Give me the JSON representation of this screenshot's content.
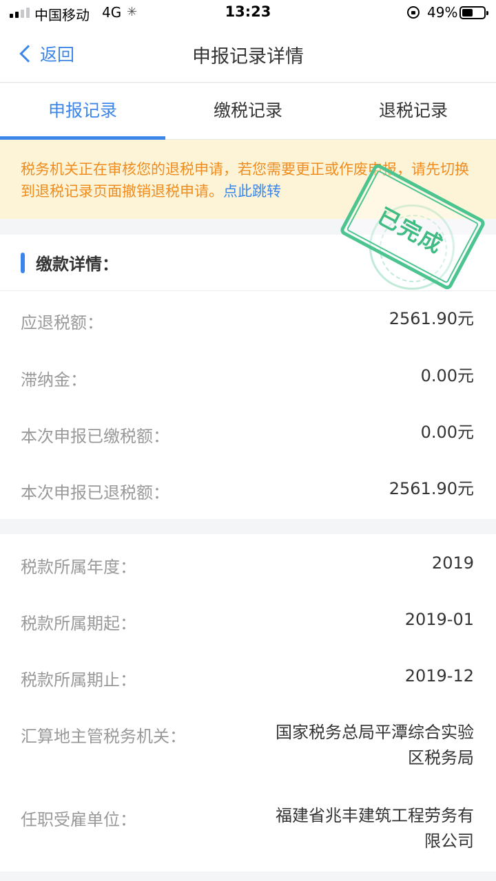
{
  "status_bar": {
    "carrier": "中国移动",
    "network": "4G",
    "time": "13:23",
    "battery_percent": "49%",
    "battery_level": 0.49
  },
  "nav": {
    "back_label": "返回",
    "title": "申报记录详情"
  },
  "tabs": [
    {
      "label": "申报记录",
      "active": true
    },
    {
      "label": "缴税记录",
      "active": false
    },
    {
      "label": "退税记录",
      "active": false
    }
  ],
  "notice": {
    "text": "税务机关正在审核您的退税申请，若您需要更正或作废申报，请先切换到退税记录页面撤销退税申请。",
    "link": "点此跳转"
  },
  "stamp": {
    "text": "已完成",
    "color": "#4cc490"
  },
  "payment_details": {
    "title": "缴款详情：",
    "rows": [
      {
        "label": "应退税额：",
        "value": "2561.90元"
      },
      {
        "label": "滞纳金：",
        "value": "0.00元"
      },
      {
        "label": "本次申报已缴税额：",
        "value": "0.00元"
      },
      {
        "label": "本次申报已退税额：",
        "value": "2561.90元"
      }
    ]
  },
  "tax_info": {
    "rows": [
      {
        "label": "税款所属年度：",
        "value": "2019"
      },
      {
        "label": "税款所属期起：",
        "value": "2019-01"
      },
      {
        "label": "税款所属期止：",
        "value": "2019-12"
      },
      {
        "label": "汇算地主管税务机关：",
        "value_lines": [
          "国家税务总局平潭综合实验",
          "区税务局"
        ]
      },
      {
        "label": "任职受雇单位：",
        "value_lines": [
          "福建省兆丰建筑工程劳务有",
          "限公司"
        ]
      }
    ]
  },
  "colors": {
    "accent": "#3b86e8",
    "notice_text": "#f08c1e",
    "notice_bg": "#fdf4d8"
  }
}
